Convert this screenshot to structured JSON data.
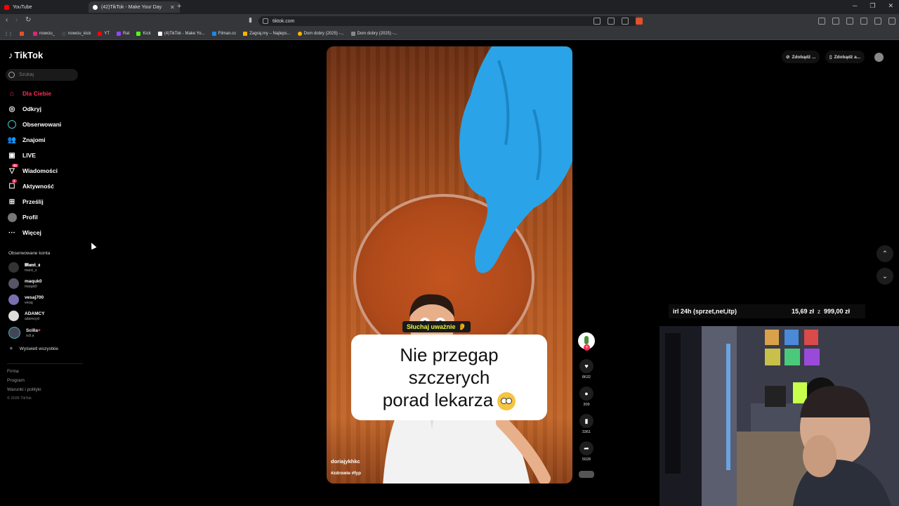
{
  "browser": {
    "tabs": [
      {
        "label": "YouTube",
        "active": false
      },
      {
        "label": "(42)TikTok - Make Your Day",
        "active": true
      }
    ],
    "url": "tiktok.com",
    "bookmarks": [
      "nowciu_",
      "nowciu_kick",
      "YT",
      "Rat",
      "Kick",
      "(4)TikTok - Make Yo...",
      "Filman.cc",
      "Zagraj.my – Najleps...",
      "Dom dobry (2025) -...",
      "Dom dobry (2025) -..."
    ]
  },
  "tiktok": {
    "logo": "TikTok",
    "search_placeholder": "Szukaj",
    "menu": [
      {
        "label": "Dla Ciebie",
        "icon": "home-icon",
        "active": true
      },
      {
        "label": "Odkryj",
        "icon": "compass-icon"
      },
      {
        "label": "Obserwowani",
        "icon": "following-icon"
      },
      {
        "label": "Znajomi",
        "icon": "friends-icon"
      },
      {
        "label": "LIVE",
        "icon": "live-icon"
      },
      {
        "label": "Wiadomości",
        "icon": "messages-icon",
        "badge": "41"
      },
      {
        "label": "Aktywność",
        "icon": "activity-icon",
        "badge": "1"
      },
      {
        "label": "Prześlij",
        "icon": "upload-icon"
      },
      {
        "label": "Profil",
        "icon": "profile-icon"
      },
      {
        "label": "Więcej",
        "icon": "more-icon"
      }
    ],
    "followed_title": "Obserwowane konta",
    "followed": [
      {
        "name": "𝕸𝖆𝖗𝖈𝖎_𝖝",
        "handle": "marci_x"
      },
      {
        "name": "maquk0",
        "handle": "maquk0"
      },
      {
        "name": "vesaj700",
        "handle": "vesaj"
      },
      {
        "name": "ADAMCY",
        "handle": "adamcyxl"
      },
      {
        "name": "Scilla",
        "handle": "scil.a"
      }
    ],
    "show_all": "Wyświetl wszystkie",
    "footer": [
      "Firma",
      "Program",
      "Warunki i polityki"
    ],
    "copyright": "© 2026 TikTok",
    "top_right": [
      "Zdobądź ...",
      "Zdobądź a..."
    ],
    "video": {
      "sticker": "Słuchaj uważnie",
      "caption_lines": [
        "Nie przegap",
        "szczerych",
        "porad lekarza"
      ],
      "username": "doriajykhkc",
      "tags": "#zdrowie #fyp",
      "likes": "8632",
      "comments": "309",
      "saves": "3361",
      "shares": "5028"
    }
  },
  "stream_overlay": {
    "goal_label": "irl 24h (sprzet,net,itp)",
    "goal_current": "15,69 zł",
    "goal_sep": "z",
    "goal_target": "999,00 zł"
  }
}
